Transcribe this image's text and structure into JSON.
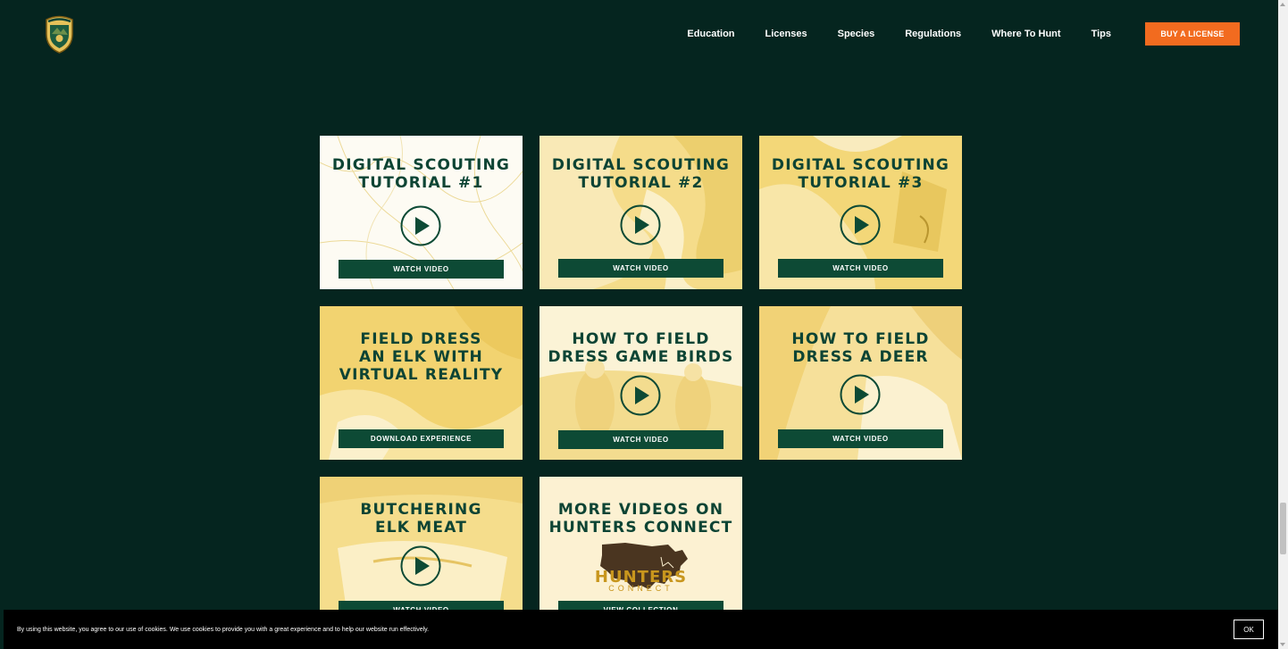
{
  "header": {
    "logo_alt": "IDAHO",
    "nav": [
      "Education",
      "Licenses",
      "Species",
      "Regulations",
      "Where To Hunt",
      "Tips"
    ],
    "buy_label": "BUY A LICENSE"
  },
  "tiles": [
    {
      "title": [
        "DIGITAL SCOUTING",
        "TUTORIAL #1"
      ],
      "button": "WATCH VIDEO"
    },
    {
      "title": [
        "DIGITAL SCOUTING",
        "TUTORIAL #2"
      ],
      "button": "WATCH VIDEO"
    },
    {
      "title": [
        "DIGITAL SCOUTING",
        "TUTORIAL #3"
      ],
      "button": "WATCH VIDEO"
    },
    {
      "title": [
        "FIELD DRESS",
        "AN ELK WITH",
        "VIRTUAL REALITY"
      ],
      "button": "DOWNLOAD EXPERIENCE"
    },
    {
      "title": [
        "HOW TO FIELD",
        "DRESS GAME BIRDS"
      ],
      "button": "WATCH VIDEO"
    },
    {
      "title": [
        "HOW TO FIELD",
        "DRESS A DEER"
      ],
      "button": "WATCH VIDEO"
    },
    {
      "title": [
        "BUTCHERING",
        "ELK MEAT"
      ],
      "button": "WATCH VIDEO"
    },
    {
      "title": [
        "MORE VIDEOS ON",
        "HUNTERS CONNECT"
      ],
      "button": "VIEW COLLECTION",
      "logo_text": [
        "HUNTERS",
        "CONNECT"
      ]
    }
  ],
  "cookie": {
    "message": "By using this website, you agree to our use of cookies. We use cookies to provide you with a great experience and to help our website run effectively.",
    "ok_label": "OK"
  },
  "colors": {
    "background": "#05251f",
    "accent": "#f26b1f",
    "title_green": "#0d4434",
    "button_green": "#0d4a35"
  }
}
